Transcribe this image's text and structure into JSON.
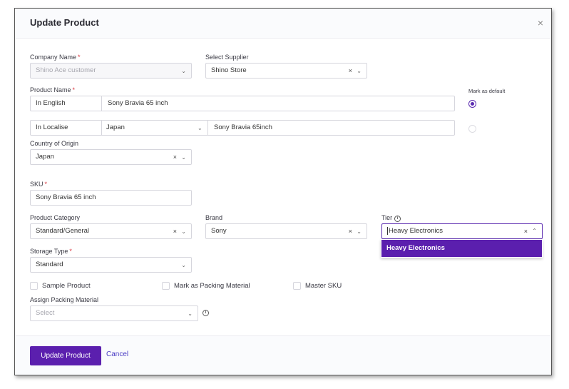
{
  "modal": {
    "title": "Update Product"
  },
  "form": {
    "company_name": {
      "label": "Company Name",
      "value": "Shino Ace customer"
    },
    "supplier": {
      "label": "Select Supplier",
      "value": "Shino Store"
    },
    "product_name": {
      "label": "Product Name",
      "english_label": "In English",
      "english_value": "Sony Bravia 65 inch",
      "localise_label": "In Localise",
      "localise_language": "Japan",
      "localise_value": "Sony Bravia 65inch",
      "mark_default_label": "Mark as default"
    },
    "country_of_origin": {
      "label": "Country of Origin",
      "value": "Japan"
    },
    "sku": {
      "label": "SKU",
      "value": "Sony Bravia 65 inch"
    },
    "product_category": {
      "label": "Product Category",
      "value": "Standard/General"
    },
    "brand": {
      "label": "Brand",
      "value": "Sony"
    },
    "tier": {
      "label": "Tier",
      "value": "Heavy Electronics",
      "options": [
        "Heavy Electronics"
      ]
    },
    "storage_type": {
      "label": "Storage Type",
      "value": "Standard"
    },
    "checkboxes": {
      "sample_product": "Sample Product",
      "packing_material": "Mark as Packing Material",
      "master_sku": "Master SKU"
    },
    "packing_material": {
      "label": "Assign Packing Material",
      "placeholder": "Select"
    }
  },
  "footer": {
    "submit_label": "Update Product",
    "cancel_label": "Cancel"
  },
  "glyphs": {
    "close": "×",
    "clear": "×",
    "chevron_down": "⌄",
    "chevron_up": "⌃",
    "required": "*",
    "info": "i"
  },
  "colors": {
    "accent": "#5b1fae",
    "required": "#d9363e",
    "link": "#4a3cc4"
  }
}
